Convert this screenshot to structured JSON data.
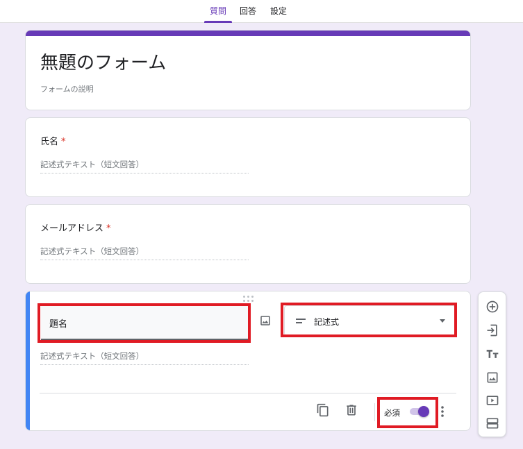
{
  "tabs": [
    {
      "label": "質問",
      "active": true
    },
    {
      "label": "回答",
      "active": false
    },
    {
      "label": "設定",
      "active": false
    }
  ],
  "form": {
    "title": "無題のフォーム",
    "description_placeholder": "フォームの説明"
  },
  "questions": [
    {
      "title": "氏名",
      "required_mark": "*",
      "answer_placeholder": "記述式テキスト（短文回答）"
    },
    {
      "title": "メールアドレス",
      "required_mark": "*",
      "answer_placeholder": "記述式テキスト（短文回答）"
    }
  ],
  "active_question": {
    "title_value": "題名",
    "type_label": "記述式",
    "answer_placeholder": "記述式テキスト（短文回答）",
    "required_label": "必須",
    "required_on": true
  },
  "icons": {
    "image": "image-icon",
    "short_answer": "short-text-icon",
    "dropdown": "dropdown-arrow-icon",
    "copy": "copy-icon",
    "delete": "trash-icon",
    "more": "more-vert-icon",
    "add_question": "add-circle-icon",
    "import": "import-questions-icon",
    "add_title": "title-text-icon",
    "add_image": "image-icon",
    "add_video": "video-icon",
    "add_section": "section-icon"
  },
  "colors": {
    "accent": "#673ab7",
    "background": "#f0ebf8",
    "active_bar": "#4285f4",
    "highlight": "#e01b24",
    "required": "#d93025"
  }
}
